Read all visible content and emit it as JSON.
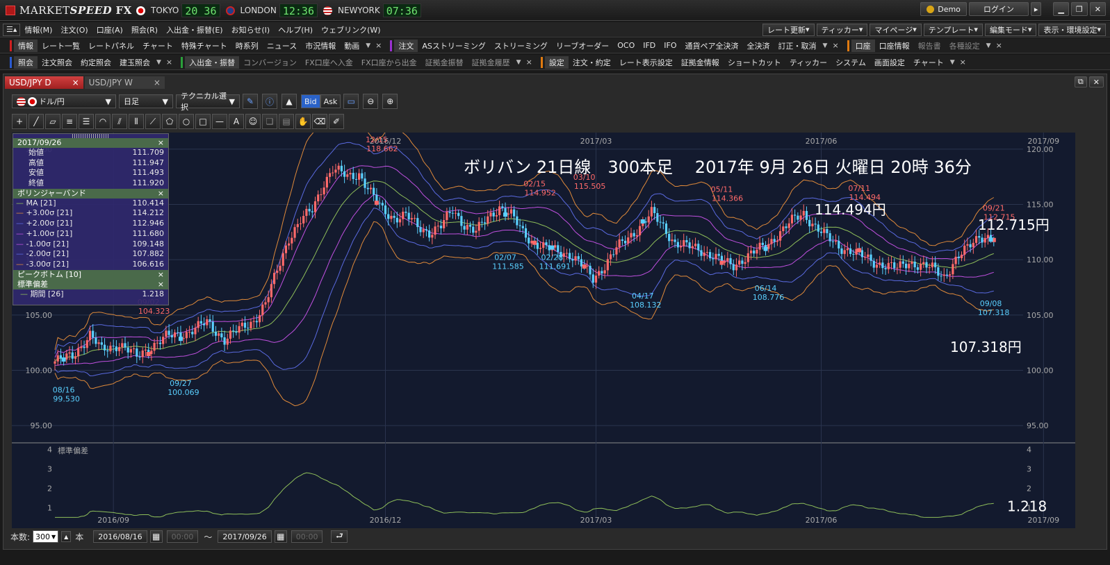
{
  "app": {
    "logo_a": "MARKET",
    "logo_b": "SPEED",
    "logo_c": "FX"
  },
  "clocks": [
    {
      "city": "TOKYO",
      "time": "20 36"
    },
    {
      "city": "LONDON",
      "time": "12:36"
    },
    {
      "city": "NEWYORK",
      "time": "07:36"
    }
  ],
  "account": {
    "demo": "Demo",
    "login": "ログイン"
  },
  "menubar": [
    "情報(M)",
    "注文(O)",
    "口座(A)",
    "照会(R)",
    "入出金・振替(E)",
    "お知らせ(I)",
    "ヘルプ(H)",
    "ウェブリンク(W)"
  ],
  "menubar_right": [
    "レート更新",
    "ティッカー",
    "マイページ",
    "テンプレート",
    "編集モード",
    "表示・環境設定"
  ],
  "row1": {
    "g1_title": "情報",
    "g1_items": [
      "レート一覧",
      "レートパネル",
      "チャート",
      "特殊チャート",
      "時系列",
      "ニュース",
      "市況情報",
      "動画"
    ],
    "g2_title": "注文",
    "g2_items": [
      "ASストリーミング",
      "ストリーミング",
      "リーブオーダー",
      "OCO",
      "IFD",
      "IFO",
      "通貨ペア全決済",
      "全決済",
      "訂正・取消"
    ],
    "g3_title": "口座",
    "g3_items": [
      "口座情報",
      "報告書",
      "各種設定"
    ]
  },
  "row2": {
    "g1_title": "照会",
    "g1_items": [
      "注文照会",
      "約定照会",
      "建玉照会"
    ],
    "g2_title": "入出金・振替",
    "g2_items": [
      "コンバージョン",
      "FX口座へ入金",
      "FX口座から出金",
      "証拠金振替",
      "証拠金履歴"
    ],
    "g3_title": "設定",
    "g3_items": [
      "注文・約定",
      "レート表示設定",
      "証拠金情報",
      "ショートカット",
      "ティッカー",
      "システム",
      "画面設定",
      "チャート"
    ]
  },
  "tabs": [
    {
      "label": "USD/JPY D",
      "active": true
    },
    {
      "label": "USD/JPY W",
      "active": false
    }
  ],
  "toolbar": {
    "pair": "ドル/円",
    "period": "日足",
    "technical": "テクニカル選択",
    "bid": "Bid",
    "ask": "Ask"
  },
  "info_panel": {
    "date": "2017/09/26",
    "ohlc": [
      {
        "k": "始値",
        "v": "111.709"
      },
      {
        "k": "高値",
        "v": "111.947"
      },
      {
        "k": "安値",
        "v": "111.493"
      },
      {
        "k": "終値",
        "v": "111.920"
      }
    ],
    "bb_title": "ボリンジャーバンド",
    "bb": [
      {
        "k": "MA [21]",
        "v": "110.414",
        "color": "#8fbf5a"
      },
      {
        "k": "+3.00σ [21]",
        "v": "114.212",
        "color": "#e08a3a"
      },
      {
        "k": "+2.00σ [21]",
        "v": "112.946",
        "color": "#5a6ae0"
      },
      {
        "k": "+1.00σ [21]",
        "v": "111.680",
        "color": "#c050e0"
      },
      {
        "k": "-1.00σ [21]",
        "v": "109.148",
        "color": "#c050e0"
      },
      {
        "k": "-2.00σ [21]",
        "v": "107.882",
        "color": "#5a6ae0"
      },
      {
        "k": "-3.00σ [21]",
        "v": "106.616",
        "color": "#e08a3a"
      }
    ],
    "pb_title": "ピークボトム [10]",
    "sd_title": "標準偏差",
    "sd_row": {
      "k": "期間 [26]",
      "v": "1.218"
    }
  },
  "chart_data": {
    "type": "candlestick",
    "overlay_title": "ボリバン 21日線　300本足　 2017年 9月 26日 火曜日 20時 36分",
    "x_ticks": [
      "2016/09",
      "2016/12",
      "2017/03",
      "2017/06",
      "2017/09"
    ],
    "y_ticks": [
      "120.00",
      "115.00",
      "110.00",
      "105.00",
      "100.00",
      "95.00"
    ],
    "ylim": [
      93.5,
      121.5
    ],
    "peaks": [
      {
        "date": "09/02",
        "value": "104.323",
        "type": "high"
      },
      {
        "date": "12/15",
        "value": "118.662",
        "type": "high"
      },
      {
        "date": "02/15",
        "value": "114.952",
        "type": "high"
      },
      {
        "date": "03/10",
        "value": "115.505",
        "type": "high"
      },
      {
        "date": "05/11",
        "value": "114.366",
        "type": "high"
      },
      {
        "date": "07/11",
        "value": "114.494",
        "type": "high"
      },
      {
        "date": "09/21",
        "value": "112.715",
        "type": "high"
      },
      {
        "date": "08/16",
        "value": "99.530",
        "type": "low"
      },
      {
        "date": "09/27",
        "value": "100.069",
        "type": "low"
      },
      {
        "date": "02/07",
        "value": "111.585",
        "type": "low"
      },
      {
        "date": "02/28",
        "value": "111.691",
        "type": "low"
      },
      {
        "date": "04/17",
        "value": "108.132",
        "type": "low"
      },
      {
        "date": "06/14",
        "value": "108.776",
        "type": "low"
      },
      {
        "date": "09/08",
        "value": "107.318",
        "type": "low"
      }
    ],
    "callouts": [
      "114.494円",
      "112.715円",
      "107.318円"
    ],
    "close_path": [
      [
        0,
        100.8
      ],
      [
        6,
        101.3
      ],
      [
        12,
        103.2
      ],
      [
        16,
        101.8
      ],
      [
        22,
        102.4
      ],
      [
        28,
        101.2
      ],
      [
        32,
        102.0
      ],
      [
        38,
        103.0
      ],
      [
        45,
        103.4
      ],
      [
        52,
        104.3
      ],
      [
        58,
        102.8
      ],
      [
        62,
        103.5
      ],
      [
        68,
        104.5
      ],
      [
        72,
        106.0
      ],
      [
        76,
        109.0
      ],
      [
        80,
        112.0
      ],
      [
        84,
        113.5
      ],
      [
        88,
        114.5
      ],
      [
        92,
        117.0
      ],
      [
        95,
        118.2
      ],
      [
        100,
        117.5
      ],
      [
        104,
        117.8
      ],
      [
        108,
        116.0
      ],
      [
        112,
        114.5
      ],
      [
        116,
        113.8
      ],
      [
        120,
        114.0
      ],
      [
        124,
        113.0
      ],
      [
        128,
        112.5
      ],
      [
        132,
        113.0
      ],
      [
        136,
        114.5
      ],
      [
        140,
        113.2
      ],
      [
        144,
        112.5
      ],
      [
        148,
        113.8
      ],
      [
        152,
        114.8
      ],
      [
        156,
        114.0
      ],
      [
        160,
        112.5
      ],
      [
        164,
        111.5
      ],
      [
        168,
        111.0
      ],
      [
        172,
        110.8
      ],
      [
        176,
        110.5
      ],
      [
        180,
        109.5
      ],
      [
        184,
        108.3
      ],
      [
        188,
        109.5
      ],
      [
        192,
        111.0
      ],
      [
        196,
        112.0
      ],
      [
        200,
        113.0
      ],
      [
        204,
        114.2
      ],
      [
        208,
        113.0
      ],
      [
        212,
        111.5
      ],
      [
        216,
        111.2
      ],
      [
        220,
        111.0
      ],
      [
        224,
        110.5
      ],
      [
        228,
        109.8
      ],
      [
        232,
        109.5
      ],
      [
        236,
        110.2
      ],
      [
        240,
        110.8
      ],
      [
        244,
        111.5
      ],
      [
        248,
        112.5
      ],
      [
        252,
        113.5
      ],
      [
        256,
        114.2
      ],
      [
        260,
        113.0
      ],
      [
        264,
        112.0
      ],
      [
        268,
        111.2
      ],
      [
        272,
        110.8
      ],
      [
        276,
        110.3
      ],
      [
        280,
        109.8
      ],
      [
        284,
        109.5
      ],
      [
        288,
        109.2
      ],
      [
        292,
        109.8
      ],
      [
        296,
        109.5
      ],
      [
        300,
        109.2
      ],
      [
        304,
        108.5
      ],
      [
        308,
        110.0
      ],
      [
        312,
        111.0
      ],
      [
        316,
        112.2
      ],
      [
        320,
        112.0
      ],
      [
        322,
        111.9
      ]
    ],
    "std_dev": {
      "label": "標準偏差",
      "y_ticks": [
        "4",
        "3",
        "2",
        "1"
      ],
      "ylim": [
        0.3,
        4.3
      ],
      "last_value": "1.218"
    }
  },
  "footer": {
    "count_label": "本数:",
    "count": "300",
    "count_unit": "本",
    "from_date": "2016/08/16",
    "from_time": "00:00",
    "tilde": "～",
    "to_date": "2017/09/26",
    "to_time": "00:00"
  }
}
